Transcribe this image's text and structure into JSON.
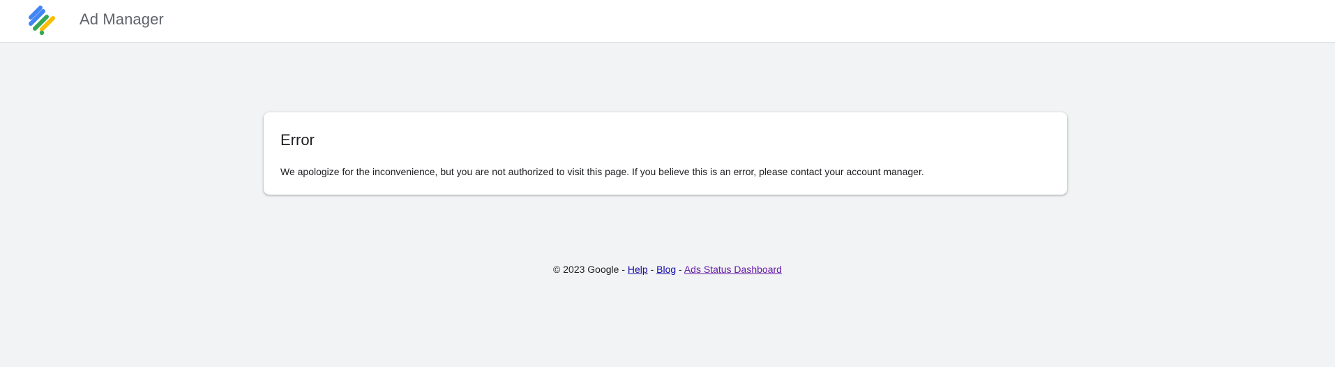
{
  "header": {
    "app_title": "Ad Manager"
  },
  "card": {
    "title": "Error",
    "message": "We apologize for the inconvenience, but you are not authorized to visit this page. If you believe this is an error, please contact your account manager."
  },
  "footer": {
    "copyright": "© 2023 Google",
    "separator": " - ",
    "links": {
      "help": "Help",
      "blog": "Blog",
      "status": "Ads Status Dashboard"
    }
  },
  "colors": {
    "background": "#f1f3f4",
    "link": "#1a0dab",
    "link_visited": "#681da8",
    "logo_blue": "#4285f4",
    "logo_green": "#34a853",
    "logo_yellow": "#fbbc04"
  },
  "icons": {
    "logo": "ad-manager-logo-icon"
  }
}
